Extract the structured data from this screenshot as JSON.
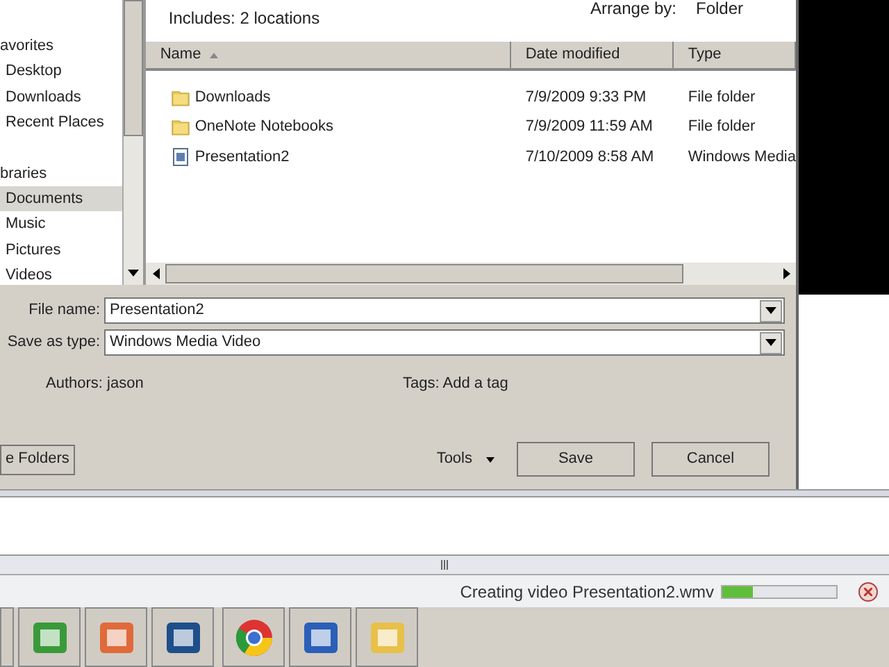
{
  "library_header": {
    "includes": "Includes:  2 locations",
    "arrange_by_label": "Arrange by:",
    "arrange_by_value": "Folder"
  },
  "nav": [
    {
      "heading": "avorites",
      "items": [
        {
          "label": "Desktop",
          "selected": false
        },
        {
          "label": "Downloads",
          "selected": false
        },
        {
          "label": "Recent Places",
          "selected": false
        }
      ]
    },
    {
      "heading": "braries",
      "items": [
        {
          "label": "Documents",
          "selected": true
        },
        {
          "label": "Music",
          "selected": false
        },
        {
          "label": "Pictures",
          "selected": false
        },
        {
          "label": "Videos",
          "selected": false
        }
      ]
    }
  ],
  "columns": [
    {
      "label": "Name",
      "sorted": true
    },
    {
      "label": "Date modified",
      "sorted": false
    },
    {
      "label": "Type",
      "sorted": false
    }
  ],
  "files": [
    {
      "kind": "folder",
      "name": "Downloads",
      "date": "7/9/2009 9:33 PM",
      "type": "File folder"
    },
    {
      "kind": "folder",
      "name": "OneNote Notebooks",
      "date": "7/9/2009 11:59 AM",
      "type": "File folder"
    },
    {
      "kind": "file",
      "name": "Presentation2",
      "date": "7/10/2009 8:58 AM",
      "type": "Windows Media"
    }
  ],
  "fields": [
    {
      "label": "File name:",
      "value": "Presentation2"
    },
    {
      "label": "Save as type:",
      "value": "Windows Media Video"
    }
  ],
  "meta": [
    {
      "label": "Authors:",
      "value": "jason"
    },
    {
      "label": "Tags:",
      "value": "Add a tag"
    }
  ],
  "buttons": {
    "folders": "e Folders",
    "tools": "Tools",
    "save": "Save",
    "cancel": "Cancel"
  },
  "status": {
    "text": "Creating video Presentation2.wmv",
    "level": 0.27
  }
}
